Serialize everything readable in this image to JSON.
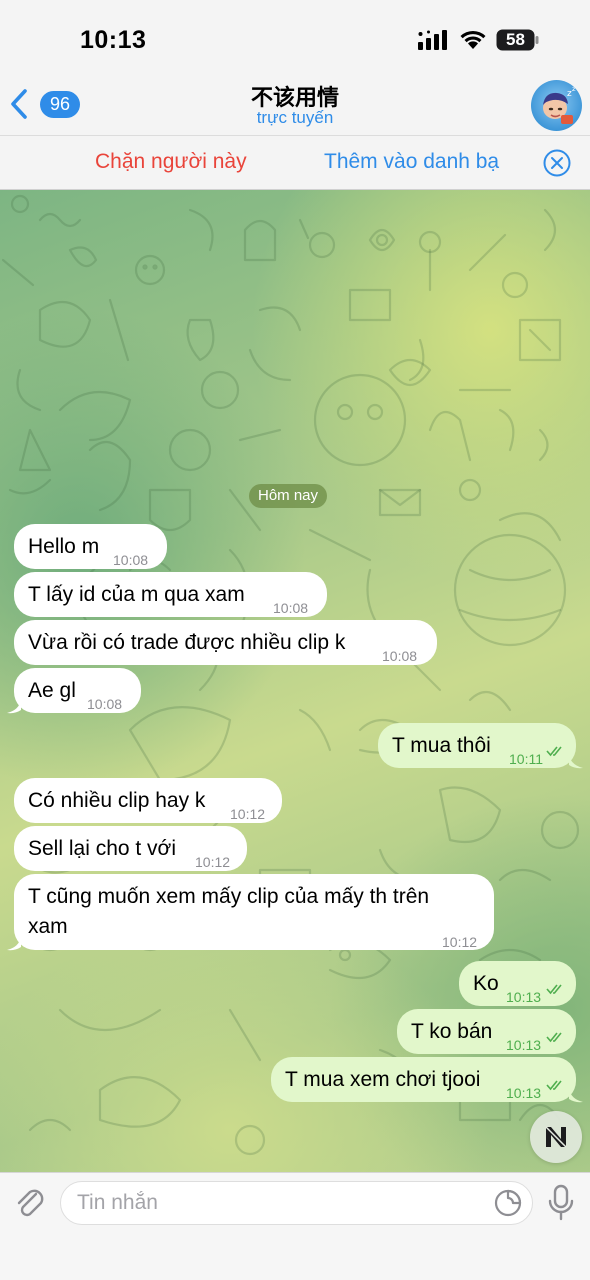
{
  "status_bar": {
    "time": "10:13",
    "battery": "58"
  },
  "header": {
    "back_count": "96",
    "title": "不该用情",
    "status": "trực tuyến"
  },
  "action_bar": {
    "block_label": "Chặn người này",
    "add_contact_label": "Thêm vào danh bạ"
  },
  "chat": {
    "date_label": "Hôm nay",
    "messages": [
      {
        "dir": "in",
        "text": "Hello m",
        "time": "10:08"
      },
      {
        "dir": "in",
        "text": "T lấy id của m qua xam",
        "time": "10:08"
      },
      {
        "dir": "in",
        "text": "Vừa rồi có trade được nhiều clip k",
        "time": "10:08"
      },
      {
        "dir": "in",
        "text": "Ae gl",
        "time": "10:08"
      },
      {
        "dir": "out",
        "text": "T mua thôi",
        "time": "10:11",
        "read": true
      },
      {
        "dir": "in",
        "text": "Có nhiều clip hay k",
        "time": "10:12"
      },
      {
        "dir": "in",
        "text": "Sell lại cho t với",
        "time": "10:12"
      },
      {
        "dir": "in",
        "text_line1": "T cũng muốn xem mấy clip của mấy th trên",
        "text_line2": "xam",
        "time": "10:12"
      },
      {
        "dir": "out",
        "text": "Ko",
        "time": "10:13",
        "read": true
      },
      {
        "dir": "out",
        "text": "T ko bán",
        "time": "10:13",
        "read": true
      },
      {
        "dir": "out",
        "text": "T mua xem chơi tjooi",
        "time": "10:13",
        "read": true
      }
    ]
  },
  "input": {
    "placeholder": "Tin nhắn"
  },
  "colors": {
    "accent": "#2f8ce8",
    "danger": "#e9443a",
    "outgoing_bubble": "#e2f7cb",
    "incoming_bubble": "#ffffff",
    "read_ticks": "#4fae4e"
  }
}
